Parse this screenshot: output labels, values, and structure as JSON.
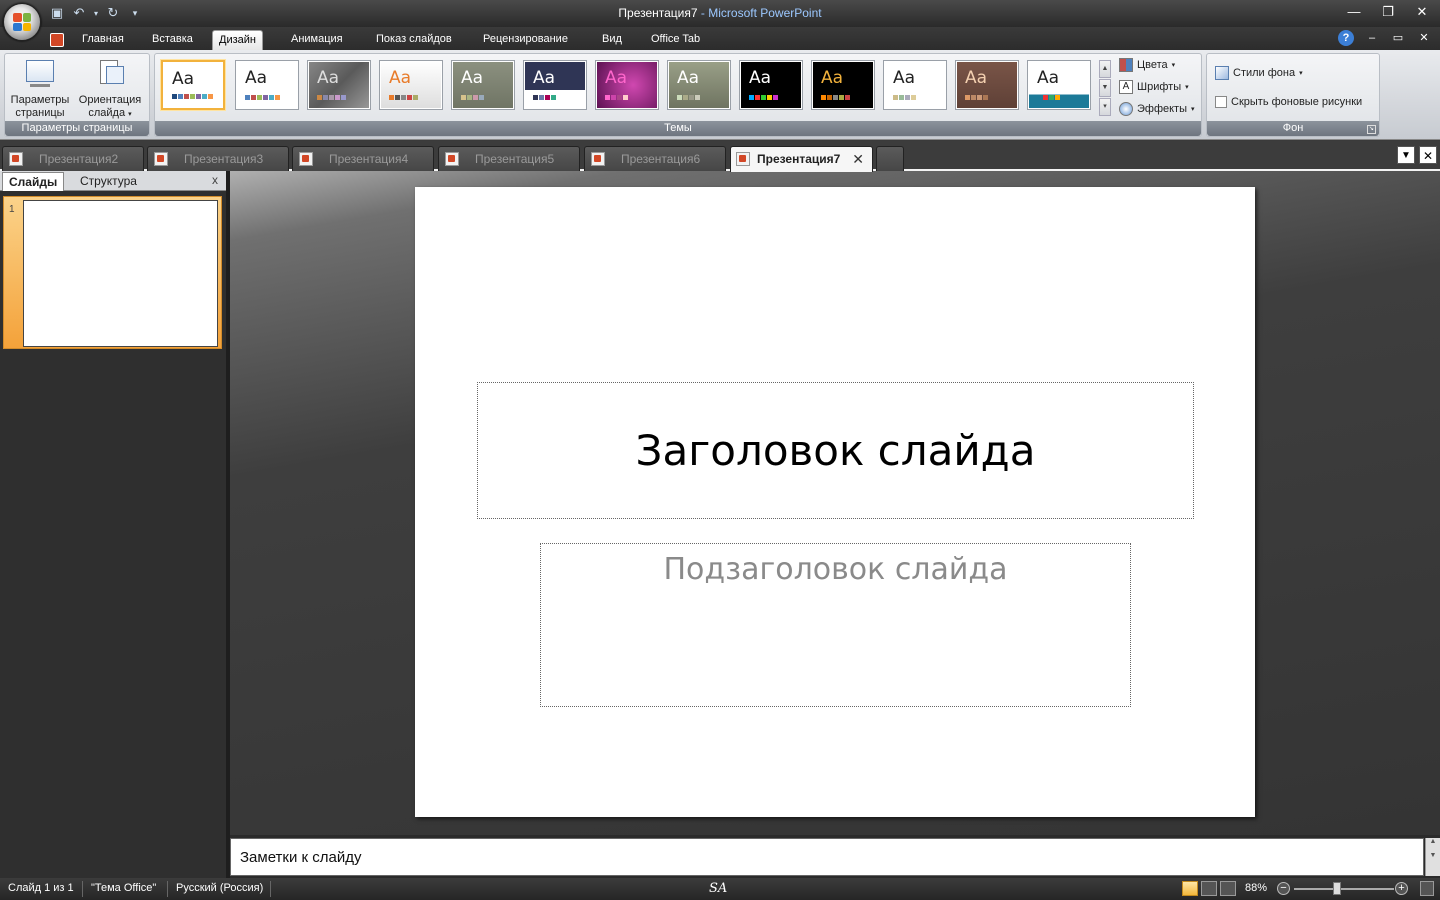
{
  "window": {
    "title_doc": "Презентация7",
    "title_sep": " - ",
    "title_app": "Microsoft PowerPoint"
  },
  "ribbon_tabs": [
    "Главная",
    "Вставка",
    "Дизайн",
    "Анимация",
    "Показ слайдов",
    "Рецензирование",
    "Вид",
    "Office Tab"
  ],
  "ribbon": {
    "page_setup": {
      "page_params": "Параметры страницы",
      "orientation": "Ориентация слайда",
      "group_label": "Параметры страницы"
    },
    "themes": {
      "group_label": "Темы",
      "thumb_text": "Aa",
      "colors": "Цвета",
      "fonts": "Шрифты",
      "effects": "Эффекты"
    },
    "background": {
      "styles": "Стили фона",
      "hide_graphics": "Скрыть фоновые рисунки",
      "group_label": "Фон"
    }
  },
  "doc_tabs": [
    "Презентация2",
    "Презентация3",
    "Презентация4",
    "Презентация5",
    "Презентация6",
    "Презентация7"
  ],
  "active_doc_tab": "Презентация7",
  "left_panel": {
    "tab_slides": "Слайды",
    "tab_outline": "Структура",
    "slide_number": "1"
  },
  "slide": {
    "title": "Заголовок слайда",
    "subtitle": "Подзаголовок слайда"
  },
  "notes": {
    "text": "Заметки к слайду"
  },
  "status": {
    "slide_counter": "Слайд 1 из 1",
    "theme": "\"Тема Office\"",
    "language": "Русский (Россия)",
    "signature": "SA",
    "zoom": "88%"
  },
  "colors": {
    "accent": "#f2b23c",
    "ppt_red": "#d24726",
    "dark_bg": "#3a3a3a"
  }
}
